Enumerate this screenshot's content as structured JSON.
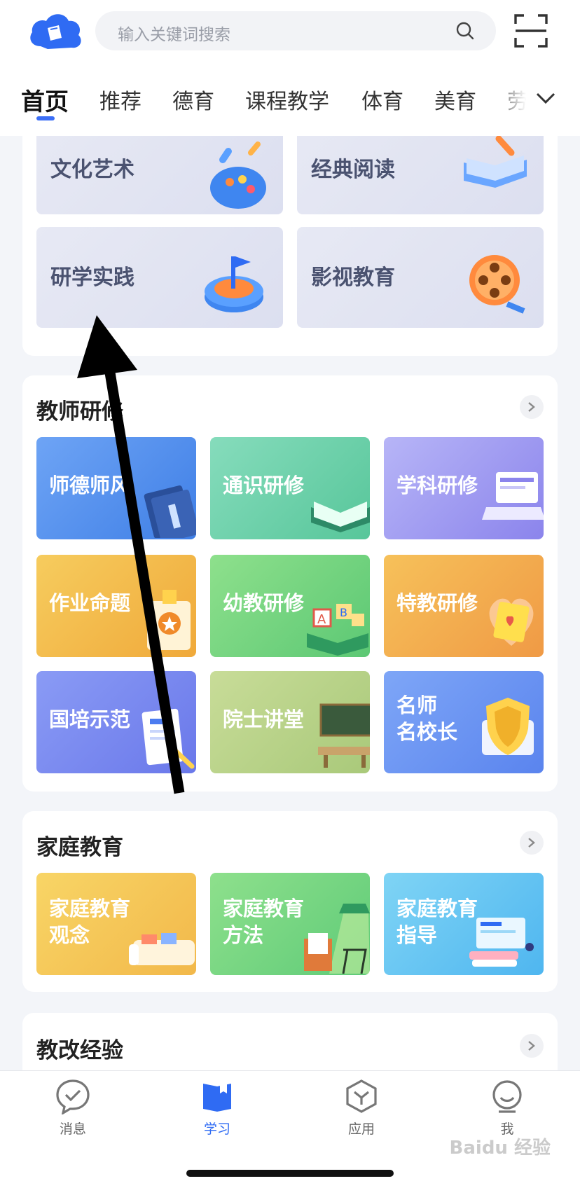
{
  "header": {
    "search_placeholder": "输入关键词搜索",
    "tabs": [
      "首页",
      "推荐",
      "德育",
      "课程教学",
      "体育",
      "美育",
      "劳"
    ]
  },
  "culture_section": {
    "tiles": [
      "文化艺术",
      "经典阅读",
      "研学实践",
      "影视教育"
    ]
  },
  "teacher_section": {
    "title": "教师研修",
    "tiles": [
      "师德师风",
      "通识研修",
      "学科研修",
      "作业命题",
      "幼教研修",
      "特教研修",
      "国培示范",
      "院士讲堂",
      "名师",
      "名校长"
    ]
  },
  "family_section": {
    "title": "家庭教育",
    "tiles": [
      {
        "line1": "家庭教育",
        "line2": "观念"
      },
      {
        "line1": "家庭教育",
        "line2": "方法"
      },
      {
        "line1": "家庭教育",
        "line2": "指导"
      }
    ]
  },
  "reform_section": {
    "title": "教改经验"
  },
  "bottom_nav": {
    "items": [
      "消息",
      "学习",
      "应用",
      "我"
    ]
  },
  "watermark": "Baidu 经验",
  "colors": {
    "accent": "#2f6bf3"
  }
}
